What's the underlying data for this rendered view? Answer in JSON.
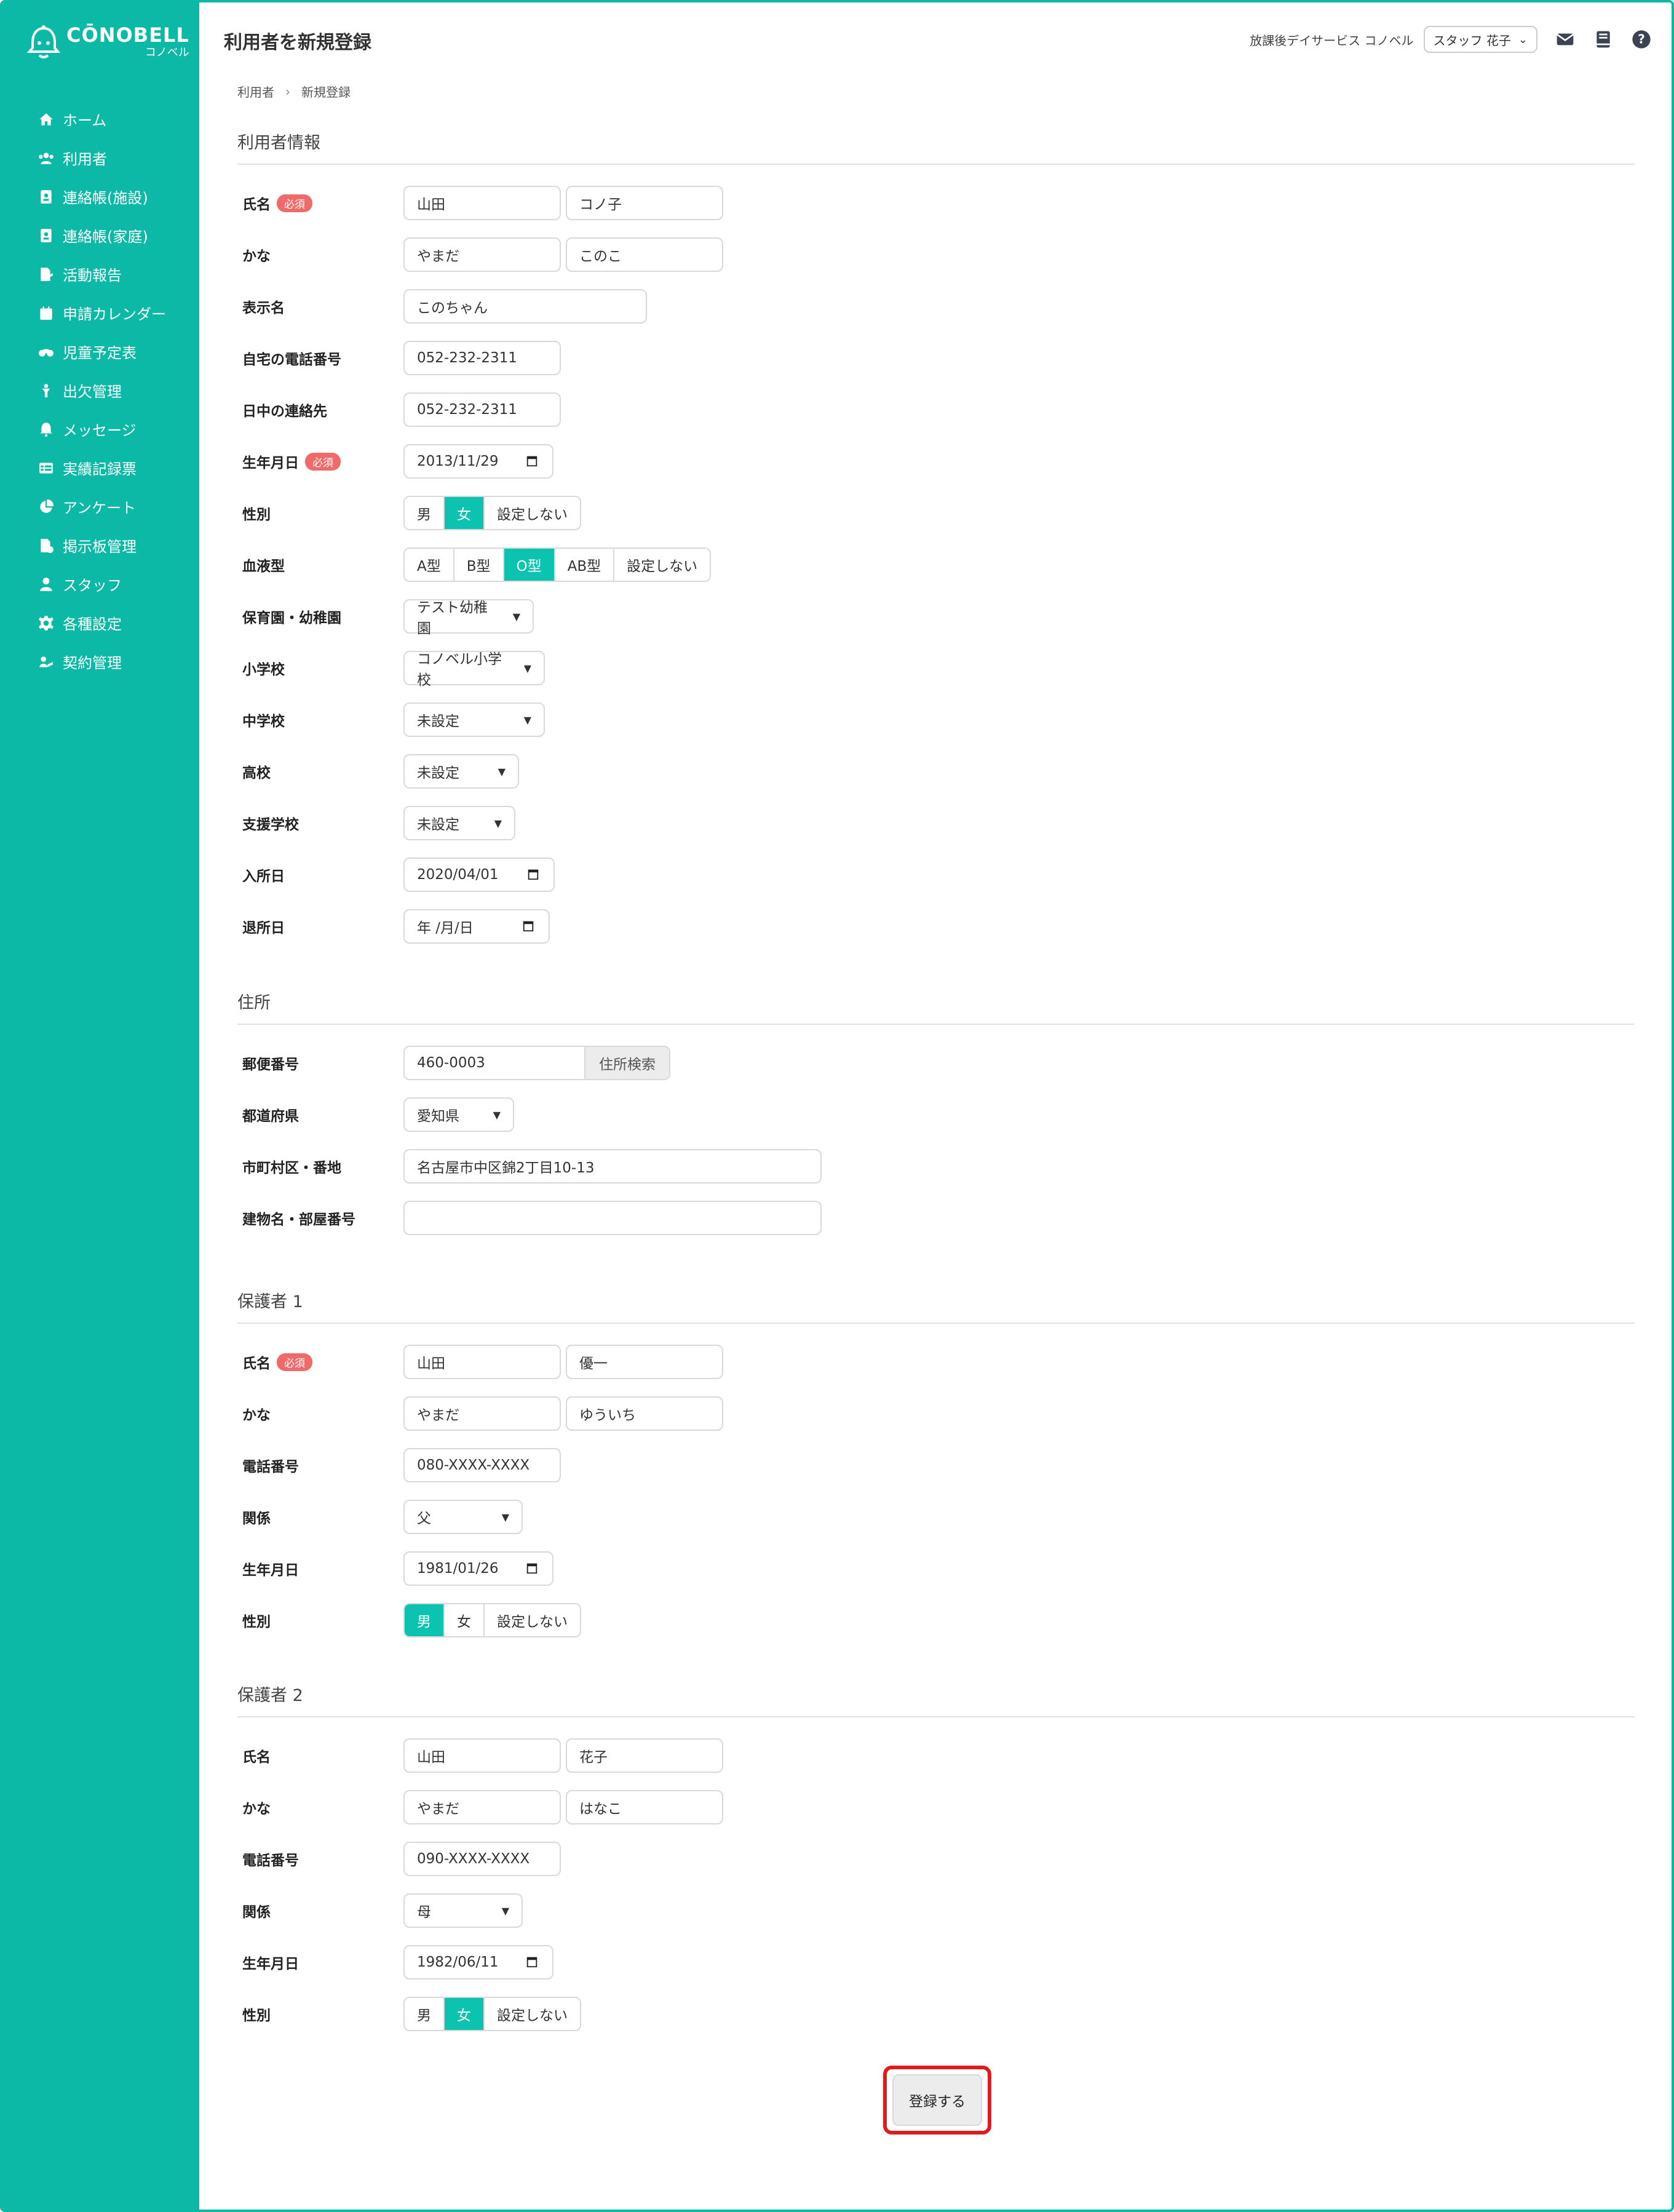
{
  "brand": {
    "name": "CŌNOBELL",
    "sub": "コノベル"
  },
  "sidebar": {
    "items": [
      {
        "label": "ホーム",
        "icon": "home-icon"
      },
      {
        "label": "利用者",
        "icon": "users-icon"
      },
      {
        "label": "連絡帳(施設)",
        "icon": "contact-book-icon"
      },
      {
        "label": "連絡帳(家庭)",
        "icon": "contact-book-icon"
      },
      {
        "label": "活動報告",
        "icon": "report-icon"
      },
      {
        "label": "申請カレンダー",
        "icon": "calendar-icon"
      },
      {
        "label": "児童予定表",
        "icon": "schedule-icon"
      },
      {
        "label": "出欠管理",
        "icon": "attendance-icon"
      },
      {
        "label": "メッセージ",
        "icon": "bell-icon"
      },
      {
        "label": "実績記録票",
        "icon": "table-icon"
      },
      {
        "label": "アンケート",
        "icon": "pie-icon"
      },
      {
        "label": "掲示板管理",
        "icon": "board-icon"
      },
      {
        "label": "スタッフ",
        "icon": "staff-icon"
      },
      {
        "label": "各種設定",
        "icon": "gear-icon"
      },
      {
        "label": "契約管理",
        "icon": "contract-icon"
      }
    ]
  },
  "header": {
    "title": "利用者を新規登録",
    "facility": "放課後デイサービス コノベル",
    "staff": "スタッフ 花子"
  },
  "breadcrumb": {
    "parent": "利用者",
    "current": "新規登録"
  },
  "required_badge": "必須",
  "sections": {
    "user": {
      "title": "利用者情報",
      "name_label": "氏名",
      "last_name": "山田",
      "first_name": "コノ子",
      "kana_label": "かな",
      "last_kana": "やまだ",
      "first_kana": "このこ",
      "display_label": "表示名",
      "display_name": "このちゃん",
      "home_tel_label": "自宅の電話番号",
      "home_tel": "052-232-2311",
      "day_tel_label": "日中の連絡先",
      "day_tel": "052-232-2311",
      "birth_label": "生年月日",
      "birth": "2013/11/29",
      "gender_label": "性別",
      "gender_options": [
        "男",
        "女",
        "設定しない"
      ],
      "gender_selected": "女",
      "blood_label": "血液型",
      "blood_options": [
        "A型",
        "B型",
        "O型",
        "AB型",
        "設定しない"
      ],
      "blood_selected": "O型",
      "kindergarten_label": "保育園・幼稚園",
      "kindergarten": "テスト幼稚園",
      "elementary_label": "小学校",
      "elementary": "コノベル小学校",
      "junior_label": "中学校",
      "junior": "未設定",
      "high_label": "高校",
      "high": "未設定",
      "support_label": "支援学校",
      "support": "未設定",
      "entry_label": "入所日",
      "entry": "2020/04/01",
      "leave_label": "退所日",
      "leave_placeholder": "年 /月/日"
    },
    "address": {
      "title": "住所",
      "zip_label": "郵便番号",
      "zip": "460-0003",
      "zip_button": "住所検索",
      "pref_label": "都道府県",
      "pref": "愛知県",
      "city_label": "市町村区・番地",
      "city": "名古屋市中区錦2丁目10-13",
      "building_label": "建物名・部屋番号",
      "building": ""
    },
    "guardian1": {
      "title": "保護者 1",
      "name_label": "氏名",
      "last_name": "山田",
      "first_name": "優一",
      "kana_label": "かな",
      "last_kana": "やまだ",
      "first_kana": "ゆういち",
      "tel_label": "電話番号",
      "tel": "080-XXXX-XXXX",
      "relation_label": "関係",
      "relation": "父",
      "birth_label": "生年月日",
      "birth": "1981/01/26",
      "gender_label": "性別",
      "gender_selected": "男"
    },
    "guardian2": {
      "title": "保護者 2",
      "name_label": "氏名",
      "last_name": "山田",
      "first_name": "花子",
      "kana_label": "かな",
      "last_kana": "やまだ",
      "first_kana": "はなこ",
      "tel_label": "電話番号",
      "tel": "090-XXXX-XXXX",
      "relation_label": "関係",
      "relation": "母",
      "birth_label": "生年月日",
      "birth": "1982/06/11",
      "gender_label": "性別",
      "gender_selected": "女"
    }
  },
  "submit": "登録する",
  "colors": {
    "accent": "#0cb8a6",
    "required": "#f06a6a",
    "highlight": "#e01b1b"
  }
}
